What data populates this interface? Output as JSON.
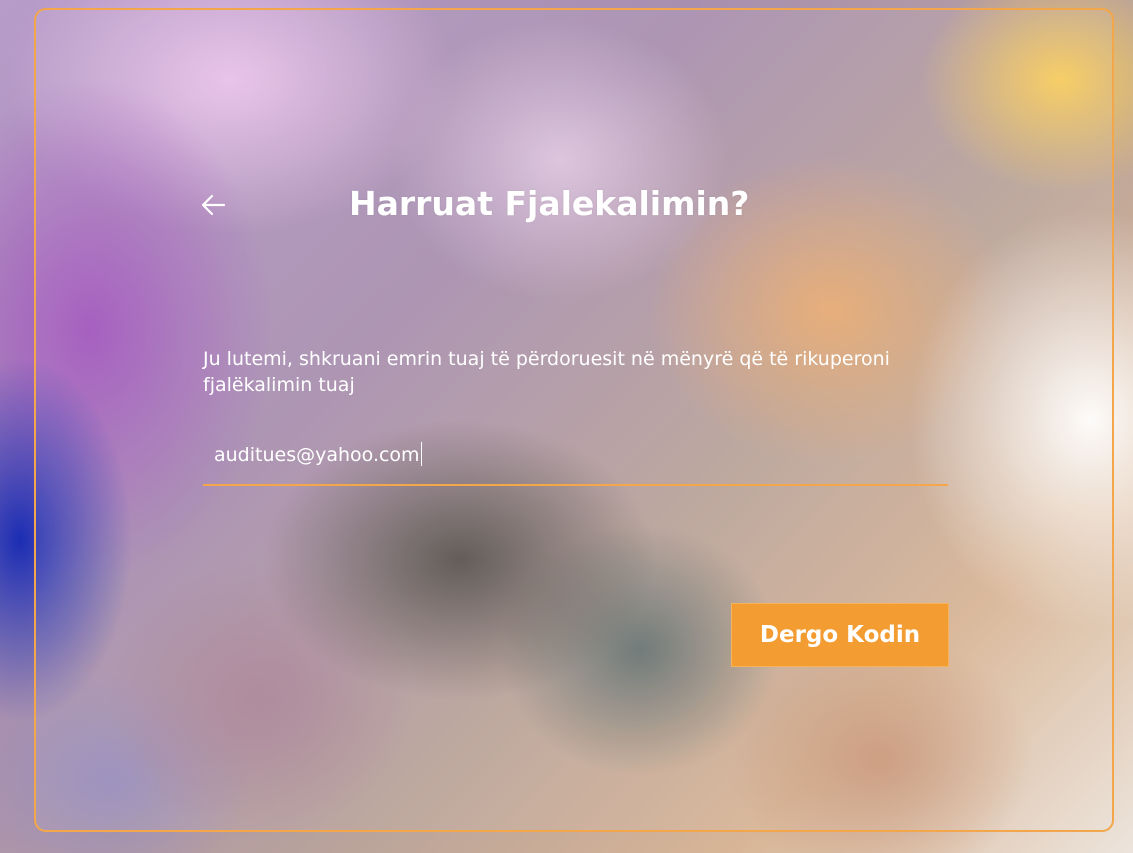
{
  "form": {
    "title": "Harruat Fjalekalimin?",
    "back_icon": "arrow-left-icon",
    "instructions": "Ju lutemi, shkruani emrin tuaj të përdoruesit në mënyrë që të rikuperoni fjalëkalimin tuaj",
    "email_value": "auditues@yahoo.com",
    "submit_label": "Dergo Kodin"
  },
  "colors": {
    "accent": "#f3a74a",
    "button": "#f39c31",
    "text": "#ffffff"
  }
}
